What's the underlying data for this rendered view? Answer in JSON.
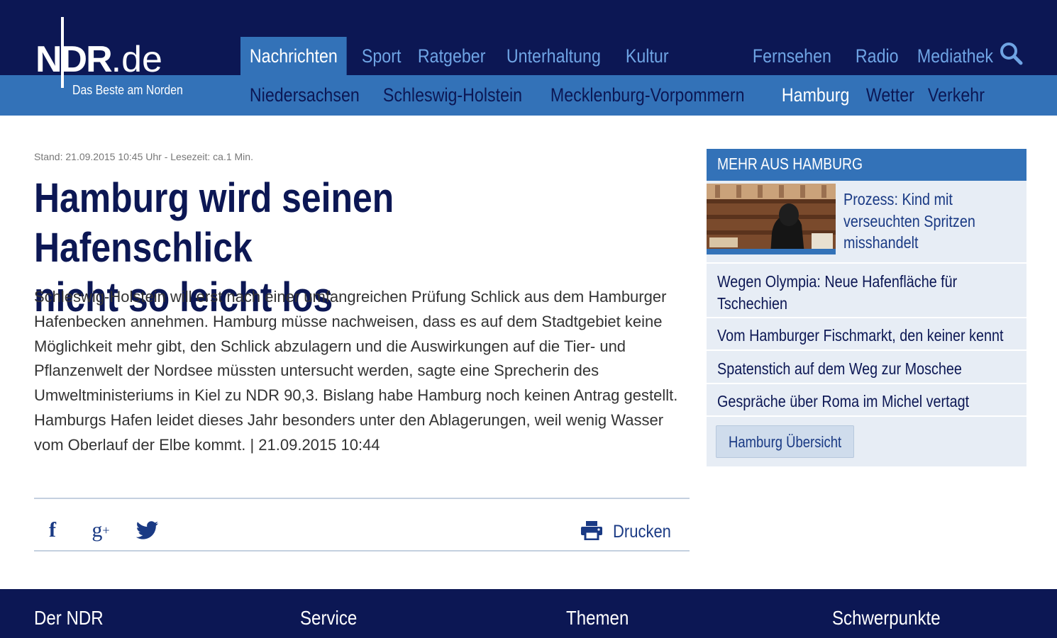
{
  "header": {
    "logo_text": "NDR",
    "logo_suffix": ".de",
    "tagline": "Das Beste am Norden",
    "main_nav": [
      "Nachrichten",
      "Sport",
      "Ratgeber",
      "Unterhaltung",
      "Kultur"
    ],
    "right_nav": [
      "Fernsehen",
      "Radio",
      "Mediathek"
    ],
    "sub_nav": [
      "Niedersachsen",
      "Schleswig-Holstein",
      "Mecklenburg-Vorpommern",
      "Hamburg",
      "Wetter",
      "Verkehr"
    ],
    "active_main": "Nachrichten",
    "active_sub": "Hamburg",
    "search_icon": "search-icon"
  },
  "article": {
    "meta": "Stand: 21.09.2015 10:45 Uhr - Lesezeit: ca.1 Min.",
    "title_line1": "Hamburg wird seinen Hafenschlick",
    "title_line2": "nicht so leicht los",
    "body": "Schleswig-Holstein will erst nach einer umfangreichen Prüfung Schlick aus dem Hamburger Hafenbecken annehmen. Hamburg müsse nachweisen, dass es auf dem Stadtgebiet keine Möglichkeit mehr gibt, den Schlick abzulagern und die Auswirkungen auf die Tier- und Pflanzenwelt der Nordsee müssten untersucht werden, sagte eine Sprecherin des Umweltministeriums in Kiel zu NDR 90,3. Bislang habe Hamburg noch keinen Antrag gestellt. Hamburgs Hafen leidet dieses Jahr besonders unter den Ablagerungen, weil wenig Wasser vom Oberlauf der Elbe kommt. | 21.09.2015 10:44",
    "share": {
      "facebook_glyph": "f",
      "gplus_glyph": "g",
      "gplus_sup": "+",
      "print_label": "Drucken"
    }
  },
  "sidebar": {
    "heading": "MEHR AUS HAMBURG",
    "teaser_line1": "Prozess: Kind mit",
    "teaser_line2": "verseuchten Spritzen",
    "teaser_line3": "misshandelt",
    "link1_line1": "Wegen Olympia: Neue Hafenfläche für",
    "link1_line2": "Tschechien",
    "link2": "Vom Hamburger Fischmarkt, den keiner kennt",
    "link3": "Spatenstich auf dem Weg zur Moschee",
    "link4": "Gespräche über Roma im Michel vertagt",
    "overview_button": "Hamburg Übersicht"
  },
  "footer": {
    "columns": [
      "Der NDR",
      "Service",
      "Themen",
      "Schwerpunkte"
    ]
  },
  "colors": {
    "header_dark": "#0c1754",
    "header_blue": "#3372b8",
    "nav_link": "#6fa4e4",
    "sidebar_bg": "#e7edf5",
    "text_dark": "#0c1754"
  }
}
